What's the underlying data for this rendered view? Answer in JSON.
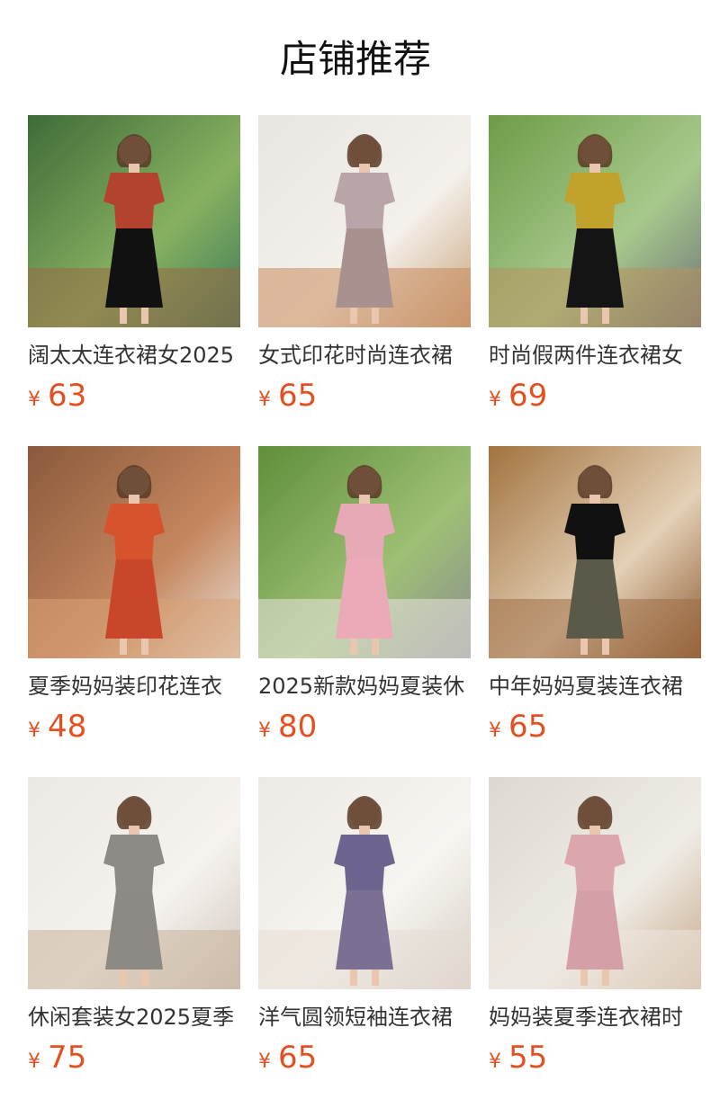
{
  "section": {
    "title": "店铺推荐"
  },
  "currency": "¥",
  "products": [
    {
      "name": "阔太太连衣裙女2025",
      "price": "63",
      "bg": [
        "#3f6b39",
        "#87b160",
        "#3e7a5a"
      ],
      "figure": "#b3422f",
      "skirt": "#111111",
      "floor": "#9a6a45"
    },
    {
      "name": "女式印花时尚连衣裙",
      "price": "65",
      "bg": [
        "#e9e5e0",
        "#f4f1ec",
        "#c9a27a"
      ],
      "figure": "#b9a4a8",
      "skirt": "#a9918f",
      "floor": "#c98b5c"
    },
    {
      "name": "时尚假两件连衣裙女",
      "price": "69",
      "bg": [
        "#6e9b48",
        "#a7c98c",
        "#6f7379"
      ],
      "figure": "#c1a22c",
      "skirt": "#141414",
      "floor": "#b8915f"
    },
    {
      "name": "夏季妈妈装印花连衣",
      "price": "48",
      "bg": [
        "#8a5a3c",
        "#c6875f",
        "#e8e1d8"
      ],
      "figure": "#d7532e",
      "skirt": "#c9462a",
      "floor": "#d9a277"
    },
    {
      "name": "2025新款妈妈夏装休",
      "price": "80",
      "bg": [
        "#5e8f3a",
        "#9fc076",
        "#8b8c8f"
      ],
      "figure": "#e7a9b6",
      "skirt": "#eaaab8",
      "floor": "#e8e4df"
    },
    {
      "name": "中年妈妈夏装连衣裙",
      "price": "65",
      "bg": [
        "#a2733f",
        "#e4d0b6",
        "#8c5a32"
      ],
      "figure": "#111111",
      "skirt": "#5b5a4a",
      "floor": "#9f6d45"
    },
    {
      "name": "休闲套装女2025夏季",
      "price": "75",
      "bg": [
        "#ece8e3",
        "#f6f3ef",
        "#d1c7bd"
      ],
      "figure": "#8e8b86",
      "skirt": "#8d8a85",
      "floor": "#c8b39b"
    },
    {
      "name": "洋气圆领短袖连衣裙",
      "price": "65",
      "bg": [
        "#ede9e4",
        "#f7f5f1",
        "#d7cfc5"
      ],
      "figure": "#6d6590",
      "skirt": "#7b7094",
      "floor": "#e5ddd3"
    },
    {
      "name": "妈妈装夏季连衣裙时",
      "price": "55",
      "bg": [
        "#ddd8d1",
        "#efece6",
        "#c8a98a"
      ],
      "figure": "#dba7ac",
      "skirt": "#d49fa6",
      "floor": "#ece6de"
    }
  ]
}
